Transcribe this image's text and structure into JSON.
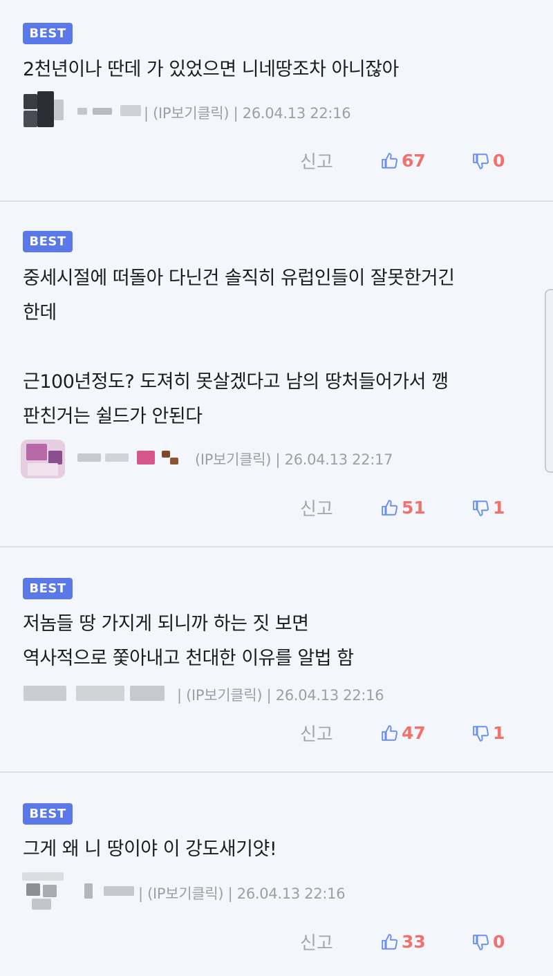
{
  "badge_label": "BEST",
  "report_label": "신고",
  "colors": {
    "badge": "#5b78e8",
    "like_icon": "#6b8fe6",
    "count": "#f0716d"
  },
  "comments": [
    {
      "lines": [
        "2천년이나 딴데 가 있었으면 니네땅조차 아니잖아"
      ],
      "meta": "| (IP보기클릭) | 26.04.13 22:16",
      "likes": "67",
      "dislikes": "0"
    },
    {
      "lines": [
        "중세시절에 떠돌아 다닌건 솔직히 유럽인들이 잘못한거긴",
        "한데",
        "",
        "근100년정도? 도져히 못살겠다고 남의 땅처들어가서 깽",
        "판친거는 쉴드가 안된다"
      ],
      "meta": "(IP보기클릭) | 26.04.13 22:17",
      "likes": "51",
      "dislikes": "1"
    },
    {
      "lines": [
        "저놈들 땅 가지게 되니까 하는 짓 보면",
        "역사적으로 쫓아내고 천대한 이유를 알법 함"
      ],
      "meta": "| (IP보기클릭) | 26.04.13 22:16",
      "likes": "47",
      "dislikes": "1"
    },
    {
      "lines": [
        "그게 왜 니 땅이야 이 강도새기얏!"
      ],
      "meta": "| (IP보기클릭) | 26.04.13 22:16",
      "likes": "33",
      "dislikes": "0"
    }
  ]
}
